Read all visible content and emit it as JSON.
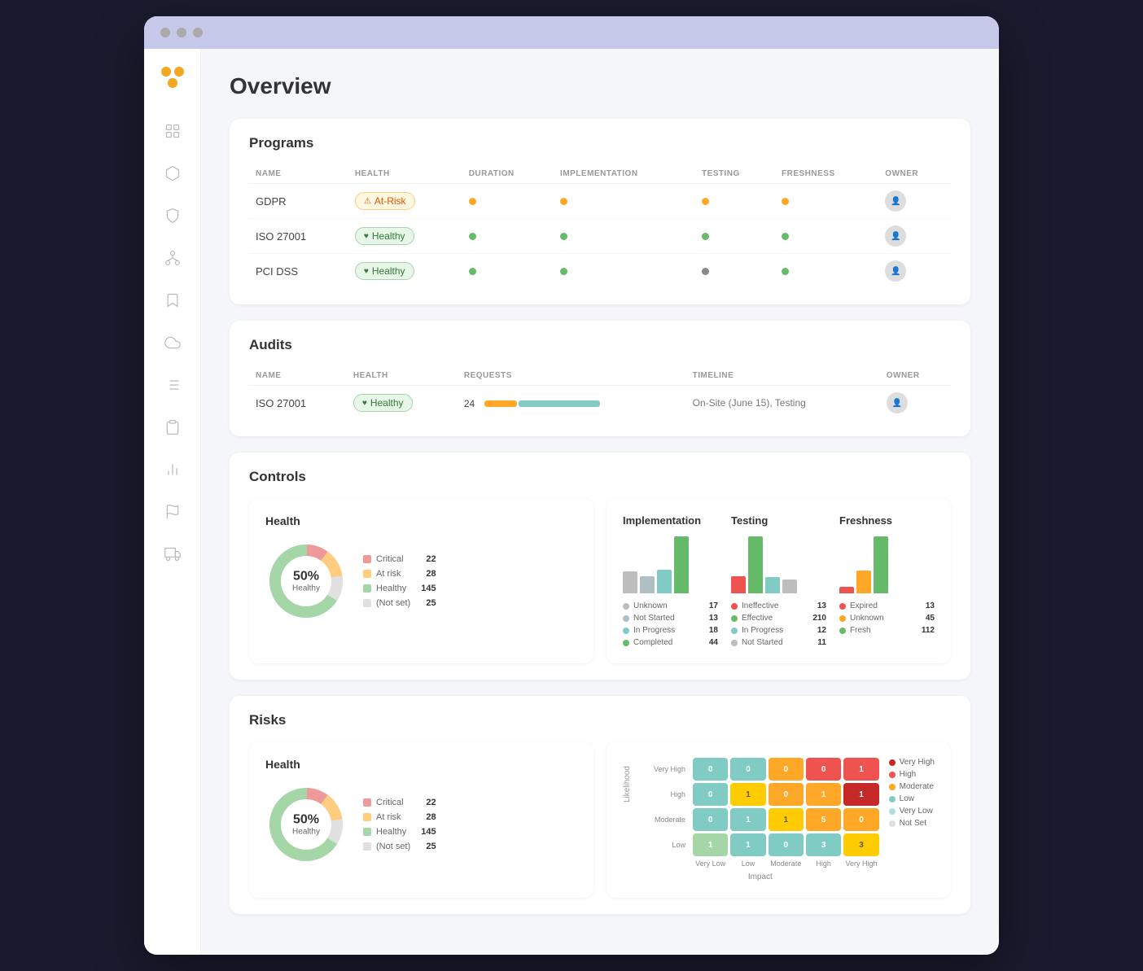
{
  "browser": {
    "dots": [
      "dot1",
      "dot2",
      "dot3"
    ]
  },
  "page": {
    "title": "Overview"
  },
  "sidebar": {
    "logo_alt": "App Logo",
    "icons": [
      "grid-icon",
      "cube-icon",
      "shield-icon",
      "network-icon",
      "bookmark-icon",
      "cloud-icon",
      "list-icon",
      "clipboard-icon",
      "chart-icon",
      "flag-icon",
      "box-icon"
    ]
  },
  "programs": {
    "section_title": "Programs",
    "columns": [
      "NAME",
      "HEALTH",
      "DURATION",
      "IMPLEMENTATION",
      "TESTING",
      "FRESHNESS",
      "OWNER"
    ],
    "rows": [
      {
        "name": "GDPR",
        "health": "At-Risk",
        "health_type": "atrisk",
        "duration": "orange",
        "implementation": "orange",
        "testing": "orange",
        "freshness": "orange",
        "owner_initials": "👤"
      },
      {
        "name": "ISO 27001",
        "health": "Healthy",
        "health_type": "healthy",
        "duration": "green",
        "implementation": "green",
        "testing": "green",
        "freshness": "green",
        "owner_initials": "👤"
      },
      {
        "name": "PCI DSS",
        "health": "Healthy",
        "health_type": "healthy",
        "duration": "green",
        "implementation": "green",
        "testing": "dark",
        "freshness": "green",
        "owner_initials": "👤"
      }
    ]
  },
  "audits": {
    "section_title": "Audits",
    "columns": [
      "NAME",
      "HEALTH",
      "REQUESTS",
      "TIMELINE",
      "OWNER"
    ],
    "rows": [
      {
        "name": "ISO 27001",
        "health": "Healthy",
        "health_type": "healthy",
        "requests": "24",
        "timeline_text": "On-Site (June 15), Testing",
        "owner_initials": "👤"
      }
    ]
  },
  "controls": {
    "section_title": "Controls",
    "health": {
      "title": "Health",
      "percent": "50%",
      "sublabel": "Healthy",
      "legend": [
        {
          "label": "Critical",
          "count": "22",
          "color": "#ef9a9a"
        },
        {
          "label": "At risk",
          "count": "28",
          "color": "#ffcc80"
        },
        {
          "label": "Healthy",
          "count": "145",
          "color": "#a5d6a7"
        },
        {
          "label": "(Not set)",
          "count": "25",
          "color": "#e0e0e0"
        }
      ]
    },
    "implementation": {
      "title": "Implementation",
      "items": [
        {
          "label": "Unknown",
          "count": "17",
          "color": "#bdbdbd"
        },
        {
          "label": "Not Started",
          "count": "13",
          "color": "#b0bec5"
        },
        {
          "label": "In Progress",
          "count": "18",
          "color": "#80cbc4"
        },
        {
          "label": "Completed",
          "count": "44",
          "color": "#66bb6a"
        }
      ]
    },
    "testing": {
      "title": "Testing",
      "items": [
        {
          "label": "Ineffective",
          "count": "13",
          "color": "#ef5350"
        },
        {
          "label": "Effective",
          "count": "210",
          "color": "#66bb6a"
        },
        {
          "label": "In Progress",
          "count": "12",
          "color": "#80cbc4"
        },
        {
          "label": "Not Started",
          "count": "11",
          "color": "#bdbdbd"
        }
      ]
    },
    "freshness": {
      "title": "Freshness",
      "items": [
        {
          "label": "Expired",
          "count": "13",
          "color": "#ef5350"
        },
        {
          "label": "Unknown",
          "count": "45",
          "color": "#ffa726"
        },
        {
          "label": "Fresh",
          "count": "112",
          "color": "#66bb6a"
        }
      ]
    }
  },
  "risks": {
    "section_title": "Risks",
    "health": {
      "title": "Health",
      "percent": "50%",
      "sublabel": "Healthy",
      "legend": [
        {
          "label": "Critical",
          "count": "22",
          "color": "#ef9a9a"
        },
        {
          "label": "At risk",
          "count": "28",
          "color": "#ffcc80"
        },
        {
          "label": "Healthy",
          "count": "145",
          "color": "#a5d6a7"
        },
        {
          "label": "(Not set)",
          "count": "25",
          "color": "#e0e0e0"
        }
      ]
    },
    "heatmap": {
      "y_label": "Likelihood",
      "x_label": "Impact",
      "row_labels": [
        "Very High",
        "High",
        "Moderate",
        "Low"
      ],
      "col_labels": [
        "Very Low",
        "Low",
        "Moderate",
        "High",
        "Very High"
      ],
      "cells": [
        [
          {
            "v": "0",
            "c": "cell-teal"
          },
          {
            "v": "0",
            "c": "cell-teal"
          },
          {
            "v": "0",
            "c": "cell-orange"
          },
          {
            "v": "0",
            "c": "cell-red"
          },
          {
            "v": "1",
            "c": "cell-red"
          }
        ],
        [
          {
            "v": "0",
            "c": "cell-teal"
          },
          {
            "v": "1",
            "c": "cell-yellow"
          },
          {
            "v": "0",
            "c": "cell-orange"
          },
          {
            "v": "1",
            "c": "cell-orange"
          },
          {
            "v": "1",
            "c": "cell-dark-red"
          }
        ],
        [
          {
            "v": "0",
            "c": "cell-teal"
          },
          {
            "v": "1",
            "c": "cell-teal"
          },
          {
            "v": "1",
            "c": "cell-yellow"
          },
          {
            "v": "5",
            "c": "cell-orange"
          },
          {
            "v": "0",
            "c": "cell-orange"
          }
        ],
        [
          {
            "v": "1",
            "c": "cell-green"
          },
          {
            "v": "1",
            "c": "cell-teal"
          },
          {
            "v": "0",
            "c": "cell-teal"
          },
          {
            "v": "3",
            "c": "cell-teal"
          },
          {
            "v": "3",
            "c": "cell-yellow"
          }
        ]
      ],
      "legend": [
        {
          "label": "Very High",
          "color": "#c62828"
        },
        {
          "label": "High",
          "color": "#ef5350"
        },
        {
          "label": "Moderate",
          "color": "#ffa726"
        },
        {
          "label": "Low",
          "color": "#80cbc4"
        },
        {
          "label": "Very Low",
          "color": "#b2dfdb"
        },
        {
          "label": "Not Set",
          "color": "#e0e0e0"
        }
      ]
    }
  }
}
